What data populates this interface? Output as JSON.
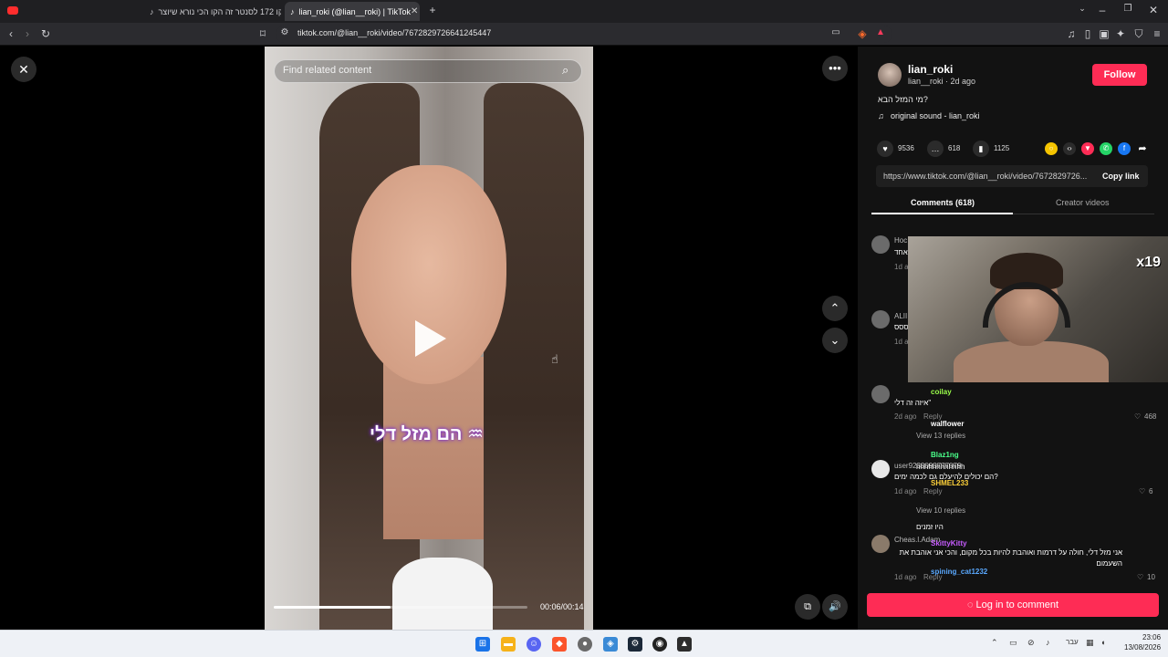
{
  "browser": {
    "tabs": [
      {
        "title": "קו 172 לסנטר זה הקו הכי נורא שיוצר"
      },
      {
        "title": "lian_roki (@lian__roki) | TikTok"
      }
    ],
    "new_tab": "+",
    "url": "tiktok.com/@lian__roki/video/7672829726641245447"
  },
  "video": {
    "search_placeholder": "Find related content",
    "caption": "הם מזל דלי ♒",
    "time": "00:06/00:14",
    "progress": 0.46
  },
  "creator": {
    "name": "lian_roki",
    "meta": "lian__roki · 2d ago",
    "description": "מי המזל הבא?",
    "sound": "original sound - lian_roki",
    "follow_label": "Follow"
  },
  "stats": {
    "likes": "9536",
    "comments": "618",
    "saves": "1125"
  },
  "link": {
    "url": "https://www.tiktok.com/@lian__roki/video/7672829726...",
    "copy_label": "Copy link"
  },
  "tabs": {
    "comments": "Comments (618)",
    "creator_videos": "Creator videos"
  },
  "comments": [
    {
      "user": "Hoc",
      "text": "אחד",
      "time": "1d a"
    },
    {
      "user": "ALII",
      "text": "ססס",
      "time": "1d a"
    },
    {
      "user": "",
      "text": "איזה זה דלי''",
      "time": "2d ago",
      "reply": "Reply",
      "likes": "468",
      "replies": "View 13 replies"
    },
    {
      "user": "user9233093777079",
      "text": "הם יכולים להיעלם גם לכמה ימים?",
      "time": "1d ago",
      "reply": "Reply",
      "likes": "6",
      "replies": "View 10 replies"
    },
    {
      "user": "Cheas.l.Adam",
      "text": "אני מזל דלי, חולה על דרמות ואוהבת להיות בכל מקום, והכי אני אוהבת את השעמום",
      "time": "1d ago",
      "reply": "Reply",
      "likes": "10"
    }
  ],
  "chat_overlay": [
    {
      "name": "coilay",
      "color": "#9aff4a"
    },
    {
      "name": "walflower",
      "color": "#ffffff"
    },
    {
      "name": "Blaz1ng",
      "color": "#4aff8a"
    },
    {
      "name": "hhhhhhhhhhhh",
      "color": "#ffffff"
    },
    {
      "name": "SHMEL233",
      "color": "#ffd23a"
    },
    {
      "name": "היו זמנים",
      "color": "#ffffff"
    },
    {
      "name": "SkittyKitty",
      "color": "#c75cff"
    },
    {
      "name": "spining_cat1232",
      "color": "#5aa9ff"
    }
  ],
  "webcam": {
    "badge": "x19"
  },
  "login_label": "Log in to comment",
  "taskbar": {
    "lang": "עבר",
    "time": "23:06",
    "date": "13/08/2026"
  },
  "colors": {
    "accent": "#fe2c55",
    "panel": "#121212",
    "background": "#000000"
  }
}
